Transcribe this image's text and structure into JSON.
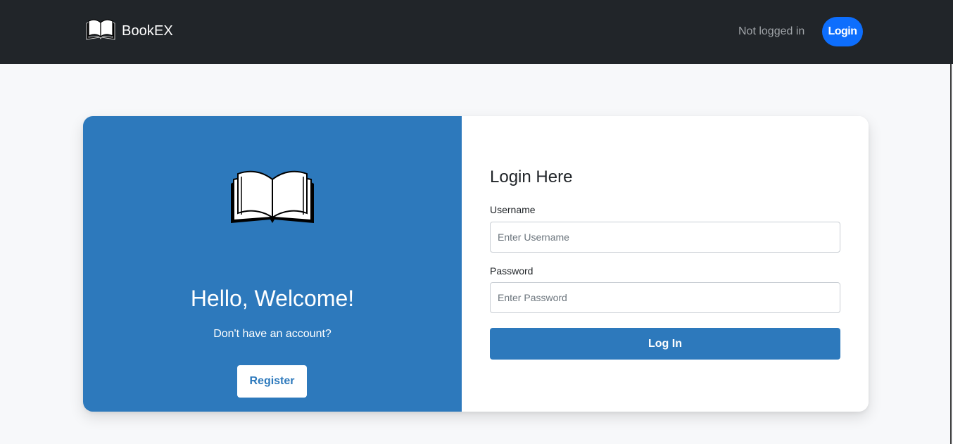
{
  "navbar": {
    "brand": "BookEX",
    "brand_icon": "open-book-icon",
    "status_text": "Not logged in",
    "login_label": "Login",
    "background": "#212529",
    "login_color": "#0d6efd"
  },
  "hero": {
    "icon": "open-book-icon",
    "title": "Hello, Welcome!",
    "subtitle": "Don't have an account?",
    "register_label": "Register",
    "background": "#2d79bc"
  },
  "form": {
    "title": "Login Here",
    "username": {
      "label": "Username",
      "placeholder": "Enter Username",
      "value": ""
    },
    "password": {
      "label": "Password",
      "placeholder": "Enter Password",
      "value": ""
    },
    "submit_label": "Log In",
    "submit_color": "#2d79bc"
  }
}
